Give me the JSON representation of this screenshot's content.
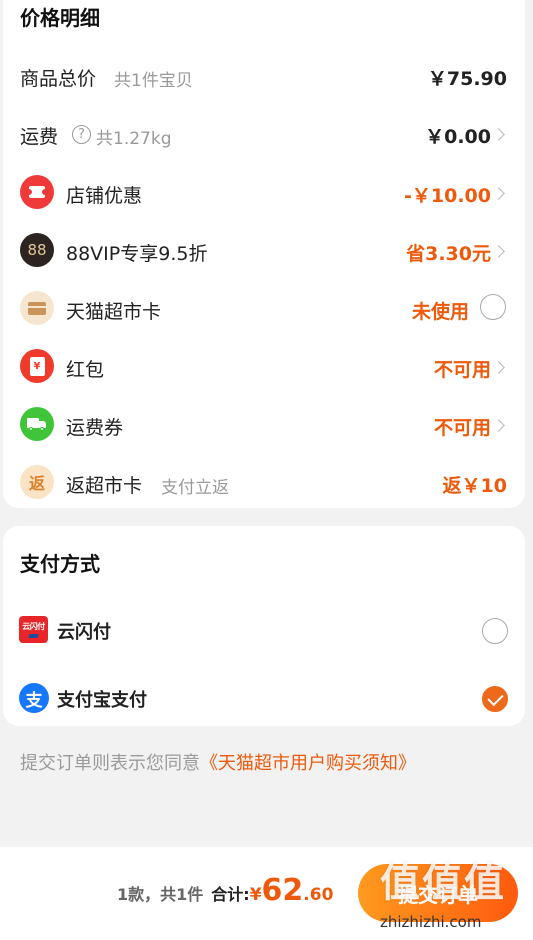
{
  "price_section": {
    "title": "价格明细",
    "rows": [
      {
        "label": "商品总价",
        "sub": "共1件宝贝",
        "value": "￥75.90"
      },
      {
        "label": "运费",
        "sub": "共1.27kg",
        "value": "￥0.00"
      },
      {
        "label": "店铺优惠",
        "value": "-￥10.00"
      },
      {
        "label": "88VIP专享9.5折",
        "value": "省3.30元"
      },
      {
        "label": "天猫超市卡",
        "value": "未使用"
      },
      {
        "label": "红包",
        "value": "不可用"
      },
      {
        "label": "运费券",
        "value": "不可用"
      },
      {
        "label": "返超市卡",
        "sub": "支付立返",
        "value": "返￥10"
      }
    ],
    "vip_icon_text": "88",
    "redpacket_icon_text": "¥",
    "cashback_icon_text": "返"
  },
  "payment_section": {
    "title": "支付方式",
    "options": [
      {
        "label": "云闪付",
        "selected": false,
        "icon_text": "云闪付"
      },
      {
        "label": "支付宝支付",
        "selected": true,
        "icon_text": "支"
      }
    ]
  },
  "agreement": {
    "prefix": "提交订单则表示您同意",
    "link": "《天猫超市用户购买须知》"
  },
  "footer": {
    "count": "1款，共1件",
    "total_label": "合计:",
    "currency": "¥",
    "total_int": "62",
    "total_dec": ".60",
    "submit_label": "提交订单"
  },
  "watermark": {
    "logo": "值",
    "url": "zhizhizhi.com"
  },
  "colors": {
    "accent": "#ee5a0c",
    "check": "#ee6a1a"
  }
}
